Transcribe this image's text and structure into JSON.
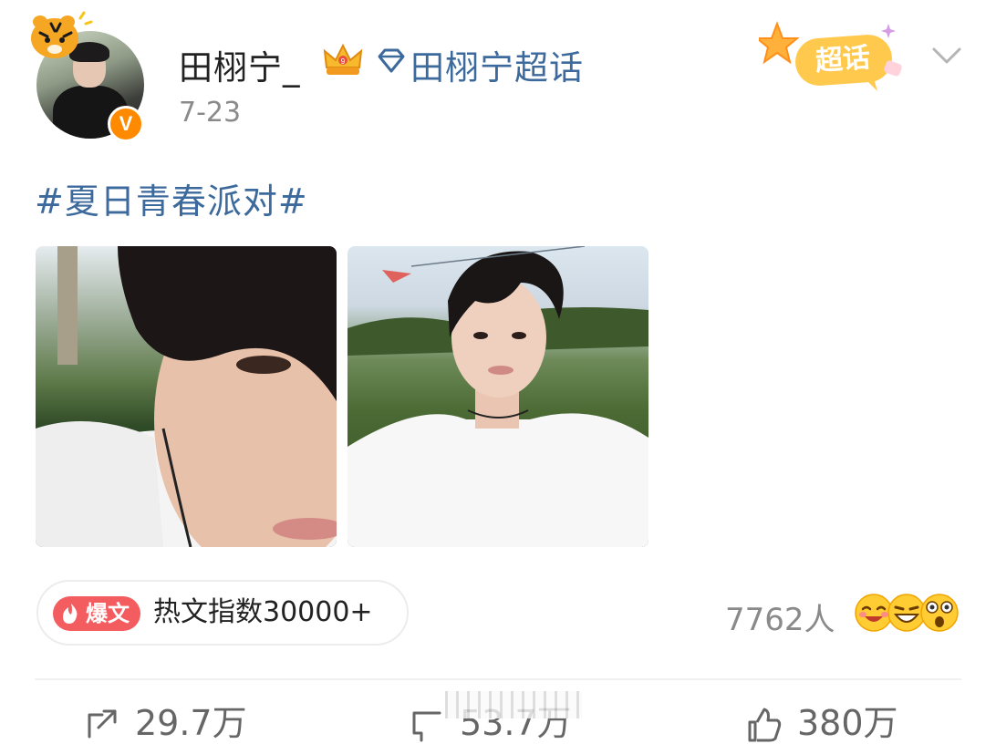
{
  "post": {
    "author": {
      "name": "田栩宁_",
      "verified_glyph": "V",
      "icons": [
        "tiger-sticker-icon",
        "crown-icon",
        "verified-icon"
      ]
    },
    "super_topic": {
      "icon": "diamond-icon",
      "label": "田栩宁超话"
    },
    "date": "7-23",
    "badge": {
      "label": "超话",
      "icon": "super-topic-star-badge-icon"
    },
    "hashtag": "#夏日青春派对#",
    "photos": [
      {
        "alt_icon": "photo-selfie-closeup"
      },
      {
        "alt_icon": "photo-selfie-grass"
      }
    ],
    "hot_article": {
      "tag_label": "爆文",
      "tag_icon": "flame-icon",
      "text": "热文指数30000+"
    },
    "reactions": {
      "count": "7762人",
      "emojis": [
        "laugh-blush-emoji",
        "grin-emoji",
        "surprised-emoji"
      ]
    },
    "actions": {
      "share": {
        "label": "29.7万",
        "icon": "share-icon"
      },
      "comment": {
        "label": "53.7万",
        "icon": "comment-icon"
      },
      "like": {
        "label": "380万",
        "icon": "thumbs-up-icon"
      }
    }
  },
  "colors": {
    "link_blue": "#3d6a9c",
    "hot_red": "#f35d5f",
    "verified_orange": "#ff8a00",
    "muted_gray": "#8a8a8a"
  }
}
